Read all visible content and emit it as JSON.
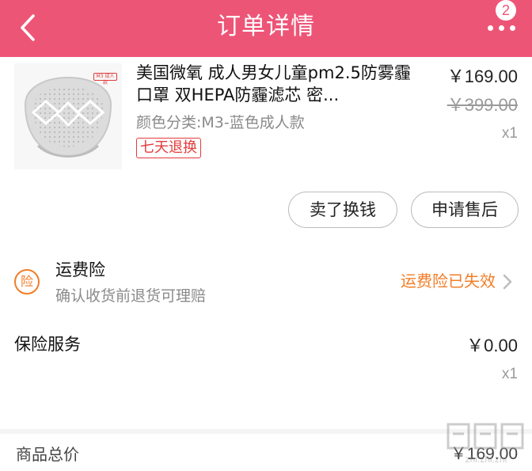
{
  "header": {
    "title": "订单详情",
    "badge_count": "2",
    "color": "#ed5577"
  },
  "product": {
    "thumb_tag": "M3 成人款",
    "title": "美国微氧 成人男女儿童pm2.5防雾霾口罩 双HEPA防霾滤芯 密...",
    "spec": "颜色分类:M3-蓝色成人款",
    "tag": "七天退换",
    "price": "￥169.00",
    "original_price": "￥399.00",
    "quantity": "x1",
    "buttons": {
      "sell": "卖了换钱",
      "after_sale": "申请售后"
    }
  },
  "shipping_insurance": {
    "icon_char": "险",
    "title": "运费险",
    "subtitle": "确认收货前退货可理赔",
    "status": "运费险已失效",
    "accent_color": "#f27d27"
  },
  "insurance_service": {
    "title": "保险服务",
    "price": "￥0.00",
    "quantity": "x1"
  },
  "summary": {
    "total_label": "商品总价",
    "total_value": "￥169.00"
  },
  "watermark": {
    "text": "zhi.zhi.zhi"
  }
}
